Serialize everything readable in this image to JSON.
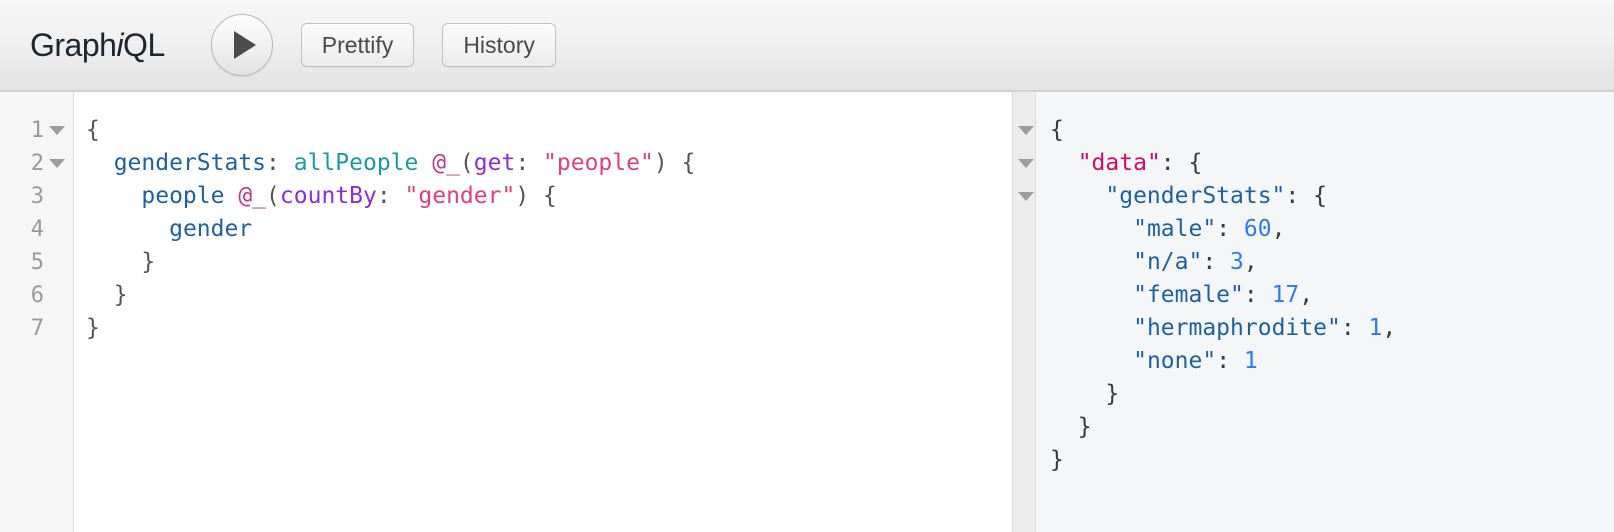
{
  "app": {
    "logo_prefix": "Graph",
    "logo_italic": "i",
    "logo_suffix": "QL"
  },
  "toolbar": {
    "execute_label": "▶",
    "prettify_label": "Prettify",
    "history_label": "History"
  },
  "query_editor": {
    "line_numbers": [
      "1",
      "2",
      "3",
      "4",
      "5",
      "6",
      "7"
    ],
    "fold_lines": [
      true,
      true,
      false,
      false,
      false,
      false,
      false
    ],
    "lines": [
      {
        "n": "1",
        "tokens": [
          {
            "t": "{",
            "c": "t-punct"
          }
        ]
      },
      {
        "n": "2",
        "tokens": [
          {
            "t": "  ",
            "c": "t-punct"
          },
          {
            "t": "genderStats",
            "c": "t-alias"
          },
          {
            "t": ": ",
            "c": "t-punct"
          },
          {
            "t": "allPeople",
            "c": "t-type"
          },
          {
            "t": " ",
            "c": "t-punct"
          },
          {
            "t": "@_",
            "c": "t-at"
          },
          {
            "t": "(",
            "c": "t-punct"
          },
          {
            "t": "get",
            "c": "t-dirarg"
          },
          {
            "t": ": ",
            "c": "t-punct"
          },
          {
            "t": "\"people\"",
            "c": "t-string"
          },
          {
            "t": ") {",
            "c": "t-punct"
          }
        ]
      },
      {
        "n": "3",
        "tokens": [
          {
            "t": "    ",
            "c": "t-punct"
          },
          {
            "t": "people",
            "c": "t-field"
          },
          {
            "t": " ",
            "c": "t-punct"
          },
          {
            "t": "@_",
            "c": "t-at"
          },
          {
            "t": "(",
            "c": "t-punct"
          },
          {
            "t": "countBy",
            "c": "t-dirarg"
          },
          {
            "t": ": ",
            "c": "t-punct"
          },
          {
            "t": "\"gender\"",
            "c": "t-string"
          },
          {
            "t": ") {",
            "c": "t-punct"
          }
        ]
      },
      {
        "n": "4",
        "tokens": [
          {
            "t": "      ",
            "c": "t-punct"
          },
          {
            "t": "gender",
            "c": "t-field"
          }
        ]
      },
      {
        "n": "5",
        "tokens": [
          {
            "t": "    }",
            "c": "t-punct"
          }
        ]
      },
      {
        "n": "6",
        "tokens": [
          {
            "t": "  }",
            "c": "t-punct"
          }
        ]
      },
      {
        "n": "7",
        "tokens": [
          {
            "t": "}",
            "c": "t-punct"
          }
        ]
      }
    ]
  },
  "result_viewer": {
    "fold_lines": [
      true,
      true,
      true,
      false,
      false,
      false,
      false,
      false,
      false,
      false,
      false
    ],
    "lines": [
      {
        "tokens": [
          {
            "t": "{",
            "c": "j-punct"
          }
        ]
      },
      {
        "tokens": [
          {
            "t": "  ",
            "c": "j-punct"
          },
          {
            "t": "\"data\"",
            "c": "j-key-data"
          },
          {
            "t": ": {",
            "c": "j-punct"
          }
        ]
      },
      {
        "tokens": [
          {
            "t": "    ",
            "c": "j-punct"
          },
          {
            "t": "\"genderStats\"",
            "c": "j-key"
          },
          {
            "t": ": {",
            "c": "j-punct"
          }
        ]
      },
      {
        "tokens": [
          {
            "t": "      ",
            "c": "j-punct"
          },
          {
            "t": "\"male\"",
            "c": "j-key"
          },
          {
            "t": ": ",
            "c": "j-punct"
          },
          {
            "t": "60",
            "c": "j-num"
          },
          {
            "t": ",",
            "c": "j-punct"
          }
        ]
      },
      {
        "tokens": [
          {
            "t": "      ",
            "c": "j-punct"
          },
          {
            "t": "\"n/a\"",
            "c": "j-key"
          },
          {
            "t": ": ",
            "c": "j-punct"
          },
          {
            "t": "3",
            "c": "j-num"
          },
          {
            "t": ",",
            "c": "j-punct"
          }
        ]
      },
      {
        "tokens": [
          {
            "t": "      ",
            "c": "j-punct"
          },
          {
            "t": "\"female\"",
            "c": "j-key"
          },
          {
            "t": ": ",
            "c": "j-punct"
          },
          {
            "t": "17",
            "c": "j-num"
          },
          {
            "t": ",",
            "c": "j-punct"
          }
        ]
      },
      {
        "tokens": [
          {
            "t": "      ",
            "c": "j-punct"
          },
          {
            "t": "\"hermaphrodite\"",
            "c": "j-key"
          },
          {
            "t": ": ",
            "c": "j-punct"
          },
          {
            "t": "1",
            "c": "j-num"
          },
          {
            "t": ",",
            "c": "j-punct"
          }
        ]
      },
      {
        "tokens": [
          {
            "t": "      ",
            "c": "j-punct"
          },
          {
            "t": "\"none\"",
            "c": "j-key"
          },
          {
            "t": ": ",
            "c": "j-punct"
          },
          {
            "t": "1",
            "c": "j-num"
          }
        ]
      },
      {
        "tokens": [
          {
            "t": "    }",
            "c": "j-punct"
          }
        ]
      },
      {
        "tokens": [
          {
            "t": "  }",
            "c": "j-punct"
          }
        ]
      },
      {
        "tokens": [
          {
            "t": "}",
            "c": "j-punct"
          }
        ]
      }
    ],
    "values": {
      "male": 60,
      "n/a": 3,
      "female": 17,
      "hermaphrodite": 1,
      "none": 1
    }
  },
  "colors": {
    "alias": "#1f61a0",
    "type": "#1c9aa0",
    "directive": "#c7358a",
    "directive_arg": "#8b2fd6",
    "string": "#e0407b",
    "json_data_key": "#d30b63",
    "json_key": "#1f61a0",
    "json_number": "#2f7bf6",
    "toolbar_bg": "#eeeeee",
    "result_bg": "#f5f6f8"
  }
}
